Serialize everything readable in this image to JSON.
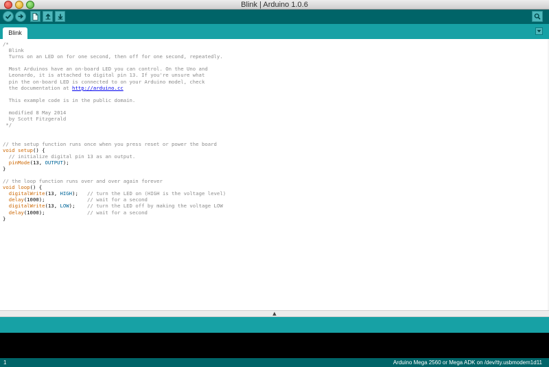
{
  "window": {
    "title": "Blink | Arduino 1.0.6"
  },
  "toolbar": {
    "verify_icon": "check-icon",
    "upload_icon": "arrow-right-icon",
    "new_icon": "new-document-icon",
    "open_icon": "open-up-arrow-icon",
    "save_icon": "save-down-arrow-icon",
    "serial_icon": "magnifier-icon"
  },
  "tabs": [
    {
      "label": "Blink"
    }
  ],
  "editor": {
    "lines": [
      [
        {
          "t": "/*",
          "c": "comment"
        }
      ],
      [
        {
          "t": "  Blink",
          "c": "comment"
        }
      ],
      [
        {
          "t": "  Turns on an LED on for one second, then off for one second, repeatedly.",
          "c": "comment"
        }
      ],
      [
        {
          "t": "",
          "c": "plain"
        }
      ],
      [
        {
          "t": "  Most Arduinos have an on-board LED you can control. On the Uno and",
          "c": "comment"
        }
      ],
      [
        {
          "t": "  Leonardo, it is attached to digital pin 13. If you're unsure what",
          "c": "comment"
        }
      ],
      [
        {
          "t": "  pin the on-board LED is connected to on your Arduino model, check",
          "c": "comment"
        }
      ],
      [
        {
          "t": "  the documentation at ",
          "c": "comment"
        },
        {
          "t": "http://arduino.cc",
          "c": "link"
        }
      ],
      [
        {
          "t": "",
          "c": "plain"
        }
      ],
      [
        {
          "t": "  This example code is in the public domain.",
          "c": "comment"
        }
      ],
      [
        {
          "t": "",
          "c": "plain"
        }
      ],
      [
        {
          "t": "  modified 8 May 2014",
          "c": "comment"
        }
      ],
      [
        {
          "t": "  by Scott Fitzgerald",
          "c": "comment"
        }
      ],
      [
        {
          "t": " */",
          "c": "comment"
        }
      ],
      [
        {
          "t": "",
          "c": "plain"
        }
      ],
      [
        {
          "t": "",
          "c": "plain"
        }
      ],
      [
        {
          "t": "// the setup function runs once when you press reset or power the board",
          "c": "comment"
        }
      ],
      [
        {
          "t": "void",
          "c": "kw"
        },
        {
          "t": " ",
          "c": "plain"
        },
        {
          "t": "setup",
          "c": "kw"
        },
        {
          "t": "() {",
          "c": "plain"
        }
      ],
      [
        {
          "t": "  // initialize digital pin 13 as an output.",
          "c": "comment"
        }
      ],
      [
        {
          "t": "  ",
          "c": "plain"
        },
        {
          "t": "pinMode",
          "c": "kw"
        },
        {
          "t": "(13, ",
          "c": "plain"
        },
        {
          "t": "OUTPUT",
          "c": "const"
        },
        {
          "t": ");",
          "c": "plain"
        }
      ],
      [
        {
          "t": "}",
          "c": "plain"
        }
      ],
      [
        {
          "t": "",
          "c": "plain"
        }
      ],
      [
        {
          "t": "// the loop function runs over and over again forever",
          "c": "comment"
        }
      ],
      [
        {
          "t": "void",
          "c": "kw"
        },
        {
          "t": " ",
          "c": "plain"
        },
        {
          "t": "loop",
          "c": "kw"
        },
        {
          "t": "() {",
          "c": "plain"
        }
      ],
      [
        {
          "t": "  ",
          "c": "plain"
        },
        {
          "t": "digitalWrite",
          "c": "kw"
        },
        {
          "t": "(13, ",
          "c": "plain"
        },
        {
          "t": "HIGH",
          "c": "const"
        },
        {
          "t": ");   ",
          "c": "plain"
        },
        {
          "t": "// turn the LED on (HIGH is the voltage level)",
          "c": "comment"
        }
      ],
      [
        {
          "t": "  ",
          "c": "plain"
        },
        {
          "t": "delay",
          "c": "kw"
        },
        {
          "t": "(1000);              ",
          "c": "plain"
        },
        {
          "t": "// wait for a second",
          "c": "comment"
        }
      ],
      [
        {
          "t": "  ",
          "c": "plain"
        },
        {
          "t": "digitalWrite",
          "c": "kw"
        },
        {
          "t": "(13, ",
          "c": "plain"
        },
        {
          "t": "LOW",
          "c": "const"
        },
        {
          "t": ");    ",
          "c": "plain"
        },
        {
          "t": "// turn the LED off by making the voltage LOW",
          "c": "comment"
        }
      ],
      [
        {
          "t": "  ",
          "c": "plain"
        },
        {
          "t": "delay",
          "c": "kw"
        },
        {
          "t": "(1000);              ",
          "c": "plain"
        },
        {
          "t": "// wait for a second",
          "c": "comment"
        }
      ],
      [
        {
          "t": "}",
          "c": "plain"
        }
      ]
    ]
  },
  "status": {
    "line_number": "1",
    "board": "Arduino Mega 2560 or Mega ADK on /dev/tty.usbmodem1d11"
  },
  "colors": {
    "toolbar": "#006468",
    "tabbar": "#17a1a5",
    "button": "#4db7bb",
    "keyword": "#cc6600",
    "constant": "#006699",
    "comment": "#8c8c8c"
  }
}
